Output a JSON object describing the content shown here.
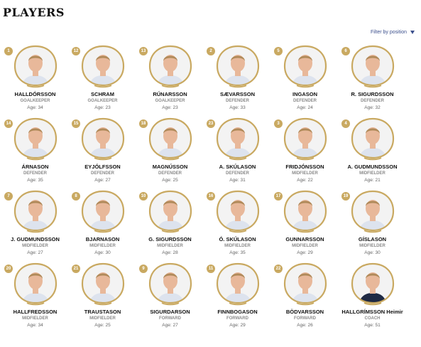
{
  "page": {
    "title": "PLAYERS"
  },
  "filter": {
    "label": "Filter by position"
  },
  "age_prefix": "Age: ",
  "players": [
    {
      "number": "1",
      "name": "HALLDÓRSSON",
      "position": "GOALKEEPER",
      "age": "34",
      "kit": "#dde3ee"
    },
    {
      "number": "12",
      "name": "SCHRAM",
      "position": "GOALKEEPER",
      "age": "23",
      "kit": "#dde3ee"
    },
    {
      "number": "13",
      "name": "RÚNARSSON",
      "position": "GOALKEEPER",
      "age": "23",
      "kit": "#dde3ee"
    },
    {
      "number": "2",
      "name": "SÆVARSSON",
      "position": "DEFENDER",
      "age": "33",
      "kit": "#dde3ee"
    },
    {
      "number": "5",
      "name": "INGASON",
      "position": "DEFENDER",
      "age": "24",
      "kit": "#dde3ee"
    },
    {
      "number": "6",
      "name": "R. SIGURDSSON",
      "position": "DEFENDER",
      "age": "32",
      "kit": "#dde3ee"
    },
    {
      "number": "14",
      "name": "ÁRNASON",
      "position": "DEFENDER",
      "age": "35",
      "kit": "#dde3ee"
    },
    {
      "number": "15",
      "name": "EYJÓLFSSON",
      "position": "DEFENDER",
      "age": "27",
      "kit": "#dde3ee"
    },
    {
      "number": "18",
      "name": "MAGNÚSSON",
      "position": "DEFENDER",
      "age": "25",
      "kit": "#dde3ee"
    },
    {
      "number": "23",
      "name": "A. SKÚLASON",
      "position": "DEFENDER",
      "age": "31",
      "kit": "#dde3ee"
    },
    {
      "number": "3",
      "name": "FRIDJÓNSSON",
      "position": "MIDFIELDER",
      "age": "22",
      "kit": "#dde3ee"
    },
    {
      "number": "4",
      "name": "A. GUDMUNDSSON",
      "position": "MIDFIELDER",
      "age": "21",
      "kit": "#dde3ee"
    },
    {
      "number": "7",
      "name": "J. GUDMUNDSSON",
      "position": "MIDFIELDER",
      "age": "27",
      "kit": "#dde3ee"
    },
    {
      "number": "8",
      "name": "BJARNASON",
      "position": "MIDFIELDER",
      "age": "30",
      "kit": "#dde3ee"
    },
    {
      "number": "10",
      "name": "G. SIGURDSSON",
      "position": "MIDFIELDER",
      "age": "28",
      "kit": "#dde3ee"
    },
    {
      "number": "16",
      "name": "Ó. SKÚLASON",
      "position": "MIDFIELDER",
      "age": "35",
      "kit": "#dde3ee"
    },
    {
      "number": "17",
      "name": "GUNNARSSON",
      "position": "MIDFIELDER",
      "age": "29",
      "kit": "#dde3ee"
    },
    {
      "number": "19",
      "name": "GÍSLASON",
      "position": "MIDFIELDER",
      "age": "30",
      "kit": "#dde3ee"
    },
    {
      "number": "20",
      "name": "HALLFREDSSON",
      "position": "MIDFIELDER",
      "age": "34",
      "kit": "#dde3ee"
    },
    {
      "number": "21",
      "name": "TRAUSTASON",
      "position": "MIDFIELDER",
      "age": "25",
      "kit": "#dde3ee"
    },
    {
      "number": "9",
      "name": "SIGURDARSON",
      "position": "FORWARD",
      "age": "27",
      "kit": "#dde3ee"
    },
    {
      "number": "11",
      "name": "FINNBOGASON",
      "position": "FORWARD",
      "age": "29",
      "kit": "#dde3ee"
    },
    {
      "number": "22",
      "name": "BÖDVARSSON",
      "position": "FORWARD",
      "age": "26",
      "kit": "#dde3ee"
    },
    {
      "number": "",
      "name": "HALLGRÍMSSON Heimir",
      "position": "COACH",
      "age": "51",
      "kit": "#1f2a44"
    }
  ],
  "colors": {
    "gold": "#c9a961",
    "skin": "#e8b89a",
    "hair": "#b08a5a",
    "accent": "#3b4f8c"
  }
}
